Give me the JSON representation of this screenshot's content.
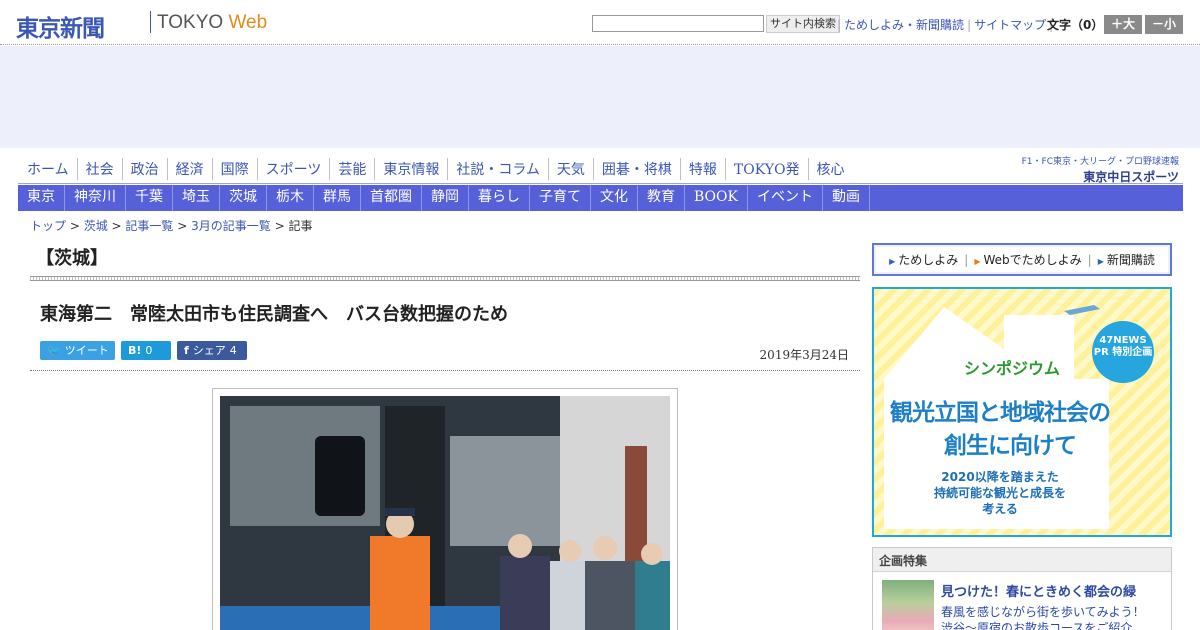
{
  "header": {
    "logo": "東京新聞",
    "logo_tokyo": "TOKYO",
    "logo_web": "Web",
    "search_button": "サイト内検索",
    "links": [
      "ためしよみ・新聞購読",
      "サイトマップ"
    ],
    "fontsize_label": "文字（0）",
    "fontsize_up": "＋大",
    "fontsize_down": "－小"
  },
  "mainnav": [
    "ホーム",
    "社会",
    "政治",
    "経済",
    "国際",
    "スポーツ",
    "芸能",
    "東京情報",
    "社説・コラム",
    "天気",
    "囲碁・将棋",
    "特報",
    "TOKYO発",
    "核心"
  ],
  "chunichi": {
    "line1": "F1・FC東京・大リーグ・プロ野球速報",
    "line2": "東京中日スポーツ"
  },
  "subnav": [
    "東京",
    "神奈川",
    "千葉",
    "埼玉",
    "茨城",
    "栃木",
    "群馬",
    "首都圏",
    "静岡",
    "暮らし",
    "子育て",
    "文化",
    "教育",
    "BOOK",
    "イベント",
    "動画"
  ],
  "breadcrumb": [
    "トップ",
    "茨城",
    "記事一覧",
    "3月の記事一覧",
    "記事"
  ],
  "section_title": "【茨城】",
  "article": {
    "headline": "東海第二　常陸太田市も住民調査へ　バス台数把握のため",
    "date": "2019年3月24日",
    "share": {
      "tweet": "ツイート",
      "hatena_count": "0",
      "facebook": "シェア",
      "facebook_count": "4"
    }
  },
  "sidebar": {
    "subscribe": [
      "ためしよみ",
      "Webでためしよみ",
      "新聞購読"
    ],
    "banner": {
      "symposium": "シンポジウム",
      "badge": "47NEWS PR 特別企画",
      "title1": "観光立国と地域社会の",
      "title2": "創生に向けて",
      "subtitle1": "2020以降を踏まえた",
      "subtitle2": "持続可能な観光と成長を",
      "subtitle3": "考える"
    },
    "planning": {
      "header": "企画特集",
      "title": "見つけた！春にときめく都会の緑",
      "desc1": "春風を感じながら街を歩いてみよう！",
      "desc2": "渋谷～原宿のお散歩コースをご紹介"
    }
  },
  "colors": {
    "brand": "#3b57b5",
    "subnav": "#5560d9",
    "ad_band": "#edf0fa"
  }
}
